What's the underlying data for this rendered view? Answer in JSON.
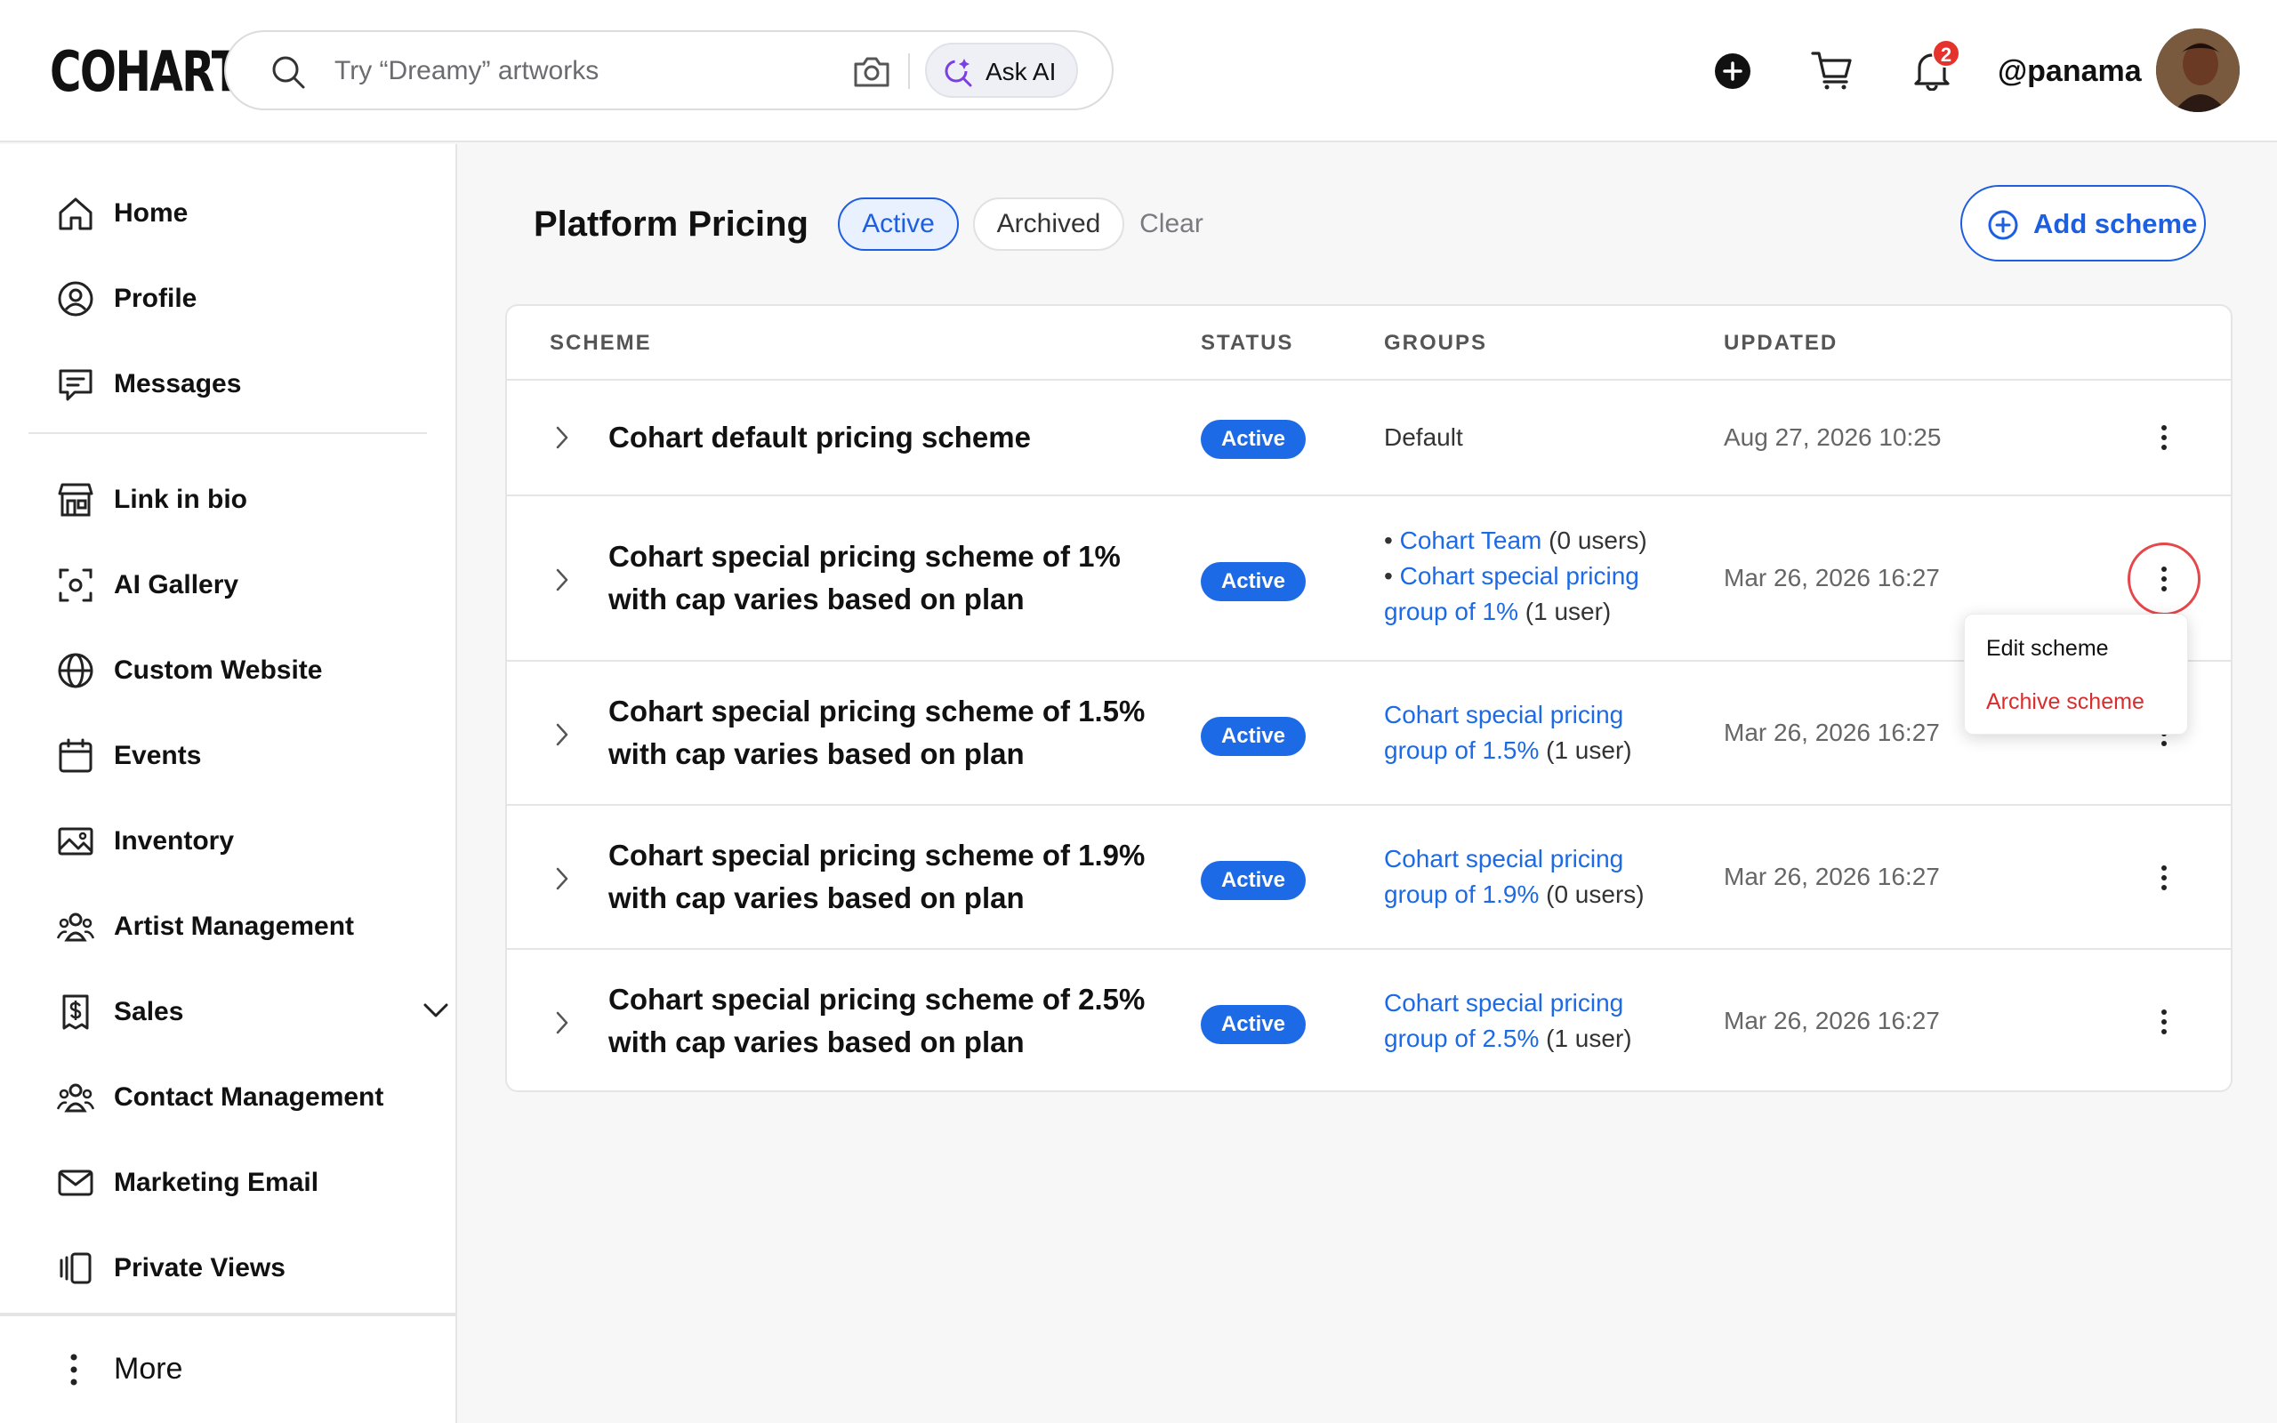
{
  "app": {
    "logo": "COHART"
  },
  "header": {
    "search_placeholder": "Try “Dreamy” artworks",
    "ask_ai_label": "Ask AI",
    "notifications_count": "2",
    "username": "@panama"
  },
  "sidebar": {
    "items": [
      {
        "label": "Home",
        "icon": "home-icon"
      },
      {
        "label": "Profile",
        "icon": "profile-icon"
      },
      {
        "label": "Messages",
        "icon": "messages-icon"
      },
      {
        "label": "Link in bio",
        "icon": "storefront-icon"
      },
      {
        "label": "AI Gallery",
        "icon": "ai-gallery-icon"
      },
      {
        "label": "Custom Website",
        "icon": "globe-icon"
      },
      {
        "label": "Events",
        "icon": "calendar-icon"
      },
      {
        "label": "Inventory",
        "icon": "image-icon"
      },
      {
        "label": "Artist Management",
        "icon": "people-icon"
      },
      {
        "label": "Sales",
        "icon": "dollar-icon"
      },
      {
        "label": "Contact Management",
        "icon": "contacts-icon"
      },
      {
        "label": "Marketing Email",
        "icon": "mail-icon"
      },
      {
        "label": "Private Views",
        "icon": "private-views-icon"
      }
    ],
    "more_label": "More"
  },
  "main": {
    "title": "Platform Pricing",
    "filters": {
      "active": "Active",
      "archived": "Archived",
      "clear": "Clear"
    },
    "add_button": "Add scheme",
    "columns": {
      "scheme": "SCHEME",
      "status": "STATUS",
      "groups": "GROUPS",
      "updated": "UPDATED"
    },
    "rows": [
      {
        "name": "Cohart default pricing scheme",
        "status": "Active",
        "group_plain": "Default",
        "updated": "Aug 27, 2026 10:25"
      },
      {
        "name": "Cohart special pricing scheme of 1% with cap varies based on plan",
        "status": "Active",
        "group_bullets": [
          {
            "link": "Cohart Team",
            "count": "(0 users)"
          },
          {
            "link_1": "Cohart special pricing",
            "link_2": "group of 1%",
            "count": "(1 user)"
          }
        ],
        "updated": "Mar 26, 2026 16:27"
      },
      {
        "name": "Cohart special pricing scheme of 1.5% with cap varies based on plan",
        "status": "Active",
        "group_link_1": "Cohart special pricing",
        "group_link_2": "group of 1.5%",
        "group_count": "(1 user)",
        "updated": "Mar 26, 2026 16:27"
      },
      {
        "name": "Cohart special pricing scheme of 1.9% with cap varies based on plan",
        "status": "Active",
        "group_link_1": "Cohart special pricing",
        "group_link_2": "group of 1.9%",
        "group_count": "(0 users)",
        "updated": "Mar 26, 2026 16:27"
      },
      {
        "name": "Cohart special pricing scheme of 2.5% with cap varies based on plan",
        "status": "Active",
        "group_link_1": "Cohart special pricing",
        "group_link_2": "group of 2.5%",
        "group_count": "(1 user)",
        "updated": "Mar 26, 2026 16:27"
      }
    ],
    "row_menu": {
      "edit": "Edit scheme",
      "archive": "Archive scheme"
    }
  },
  "colors": {
    "accent": "#1d5fe0",
    "badge": "#1d6ae6",
    "danger": "#d92d2d",
    "notification": "#e5322d"
  }
}
